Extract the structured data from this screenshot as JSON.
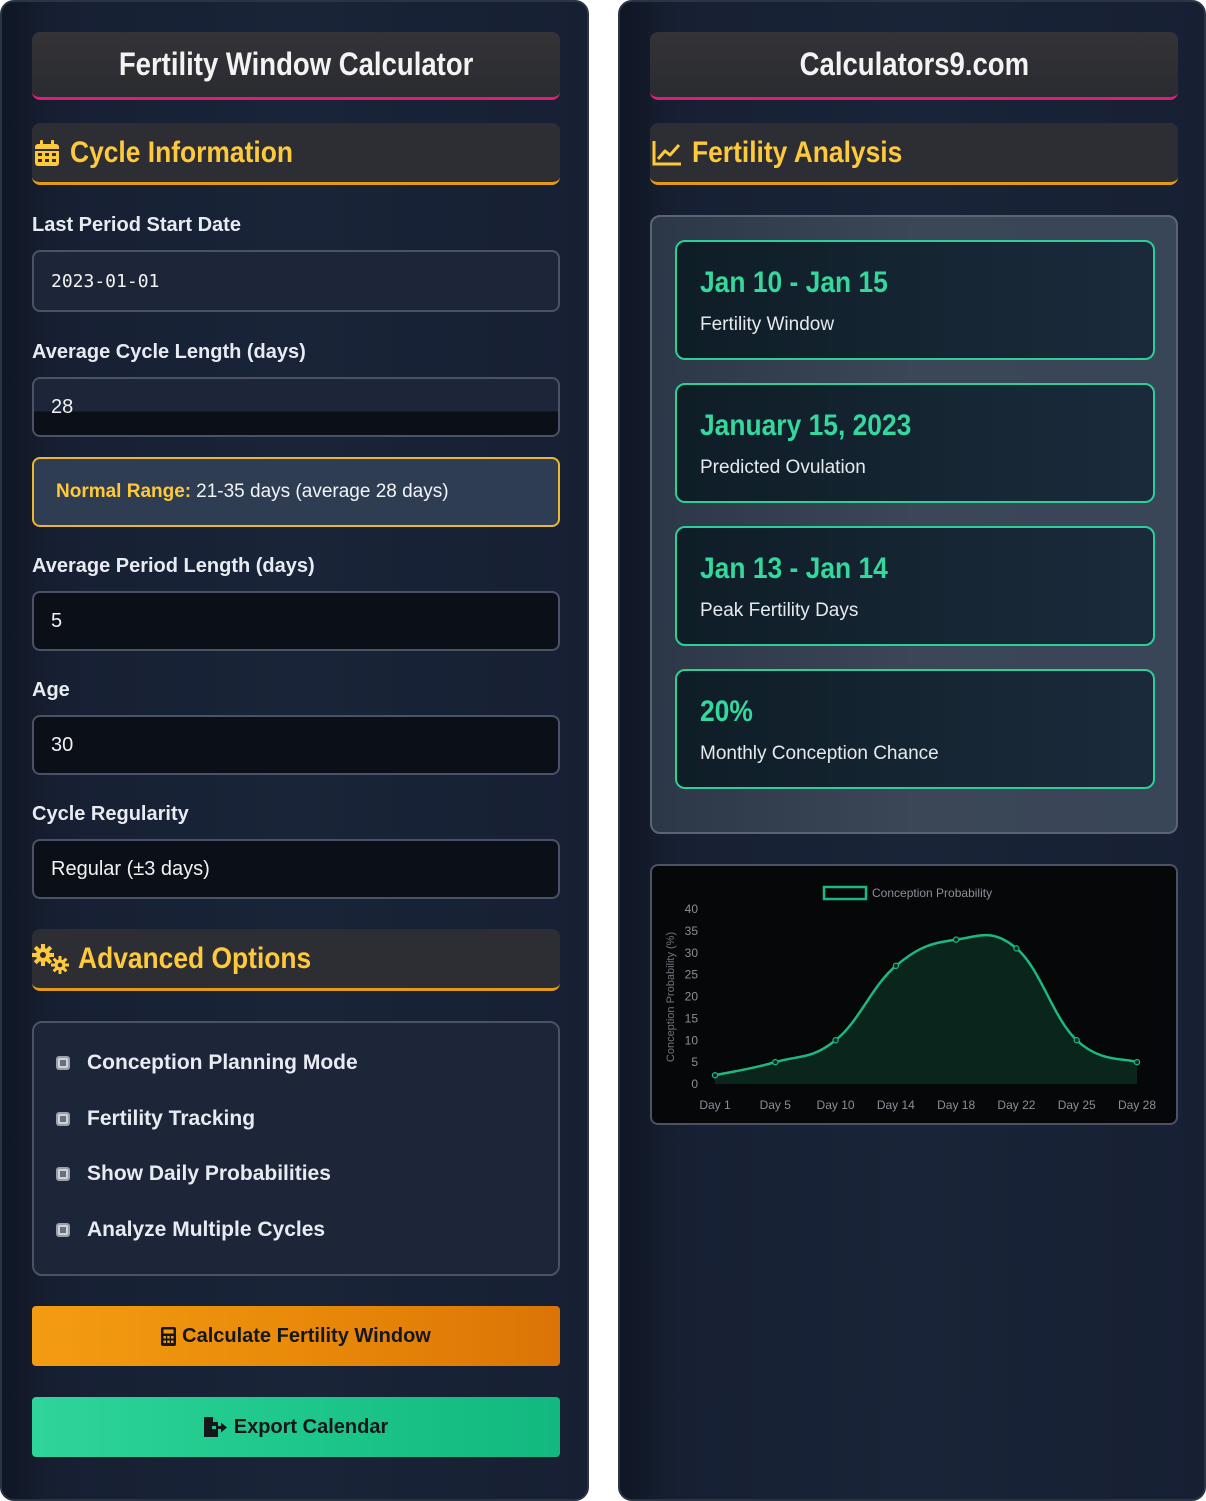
{
  "left": {
    "title": "Fertility Window Calculator",
    "cycle_section": {
      "icon": "calendar-icon",
      "title": "Cycle Information"
    },
    "fields": {
      "last_period": {
        "label": "Last Period Start Date",
        "value": "2023-01-01"
      },
      "cycle_length": {
        "label": "Average Cycle Length (days)",
        "value": "28"
      },
      "period_length": {
        "label": "Average Period Length (days)",
        "value": "5"
      },
      "age": {
        "label": "Age",
        "value": "30"
      },
      "regularity": {
        "label": "Cycle Regularity",
        "value": "Regular (±3 days)"
      }
    },
    "normal_range": {
      "label": "Normal Range:",
      "text": "21-35 days (average 28 days)"
    },
    "advanced_section": {
      "icon": "gears-icon",
      "title": "Advanced Options"
    },
    "options": [
      {
        "label": "Conception Planning Mode",
        "checked": false
      },
      {
        "label": "Fertility Tracking",
        "checked": false
      },
      {
        "label": "Show Daily Probabilities",
        "checked": false
      },
      {
        "label": "Analyze Multiple Cycles",
        "checked": false
      }
    ],
    "buttons": {
      "calculate": {
        "icon": "calculator-icon",
        "label": "Calculate Fertility Window",
        "color": "#f39c12"
      },
      "export": {
        "icon": "file-export-icon",
        "label": "Export Calendar",
        "color": "#1ec78b"
      }
    }
  },
  "right": {
    "title": "Calculators9.com",
    "analysis_section": {
      "icon": "chart-line-icon",
      "title": "Fertility Analysis"
    },
    "results": [
      {
        "value": "Jan 10 - Jan 15",
        "caption": "Fertility Window"
      },
      {
        "value": "January 15, 2023",
        "caption": "Predicted Ovulation"
      },
      {
        "value": "Jan 13 - Jan 14",
        "caption": "Peak Fertility Days"
      },
      {
        "value": "20%",
        "caption": "Monthly Conception Chance"
      }
    ]
  },
  "colors": {
    "accent_gold": "#ffc93c",
    "accent_green": "#2bcf97",
    "accent_pink": "#e01c7a",
    "accent_orange": "#e39b16"
  },
  "chart_data": {
    "type": "line",
    "categories": [
      "Day 1",
      "Day 5",
      "Day 10",
      "Day 14",
      "Day 18",
      "Day 22",
      "Day 25",
      "Day 28"
    ],
    "series": [
      {
        "name": "Conception Probability",
        "values": [
          2,
          5,
          10,
          27,
          33,
          31,
          10,
          5
        ],
        "color": "#1db87f"
      }
    ],
    "ylabel": "Conception Probability (%)",
    "ylim": [
      0,
      40
    ],
    "yticks": [
      0,
      5,
      10,
      15,
      20,
      25,
      30,
      35,
      40
    ],
    "fill": true,
    "legend": "top",
    "grid": false
  }
}
